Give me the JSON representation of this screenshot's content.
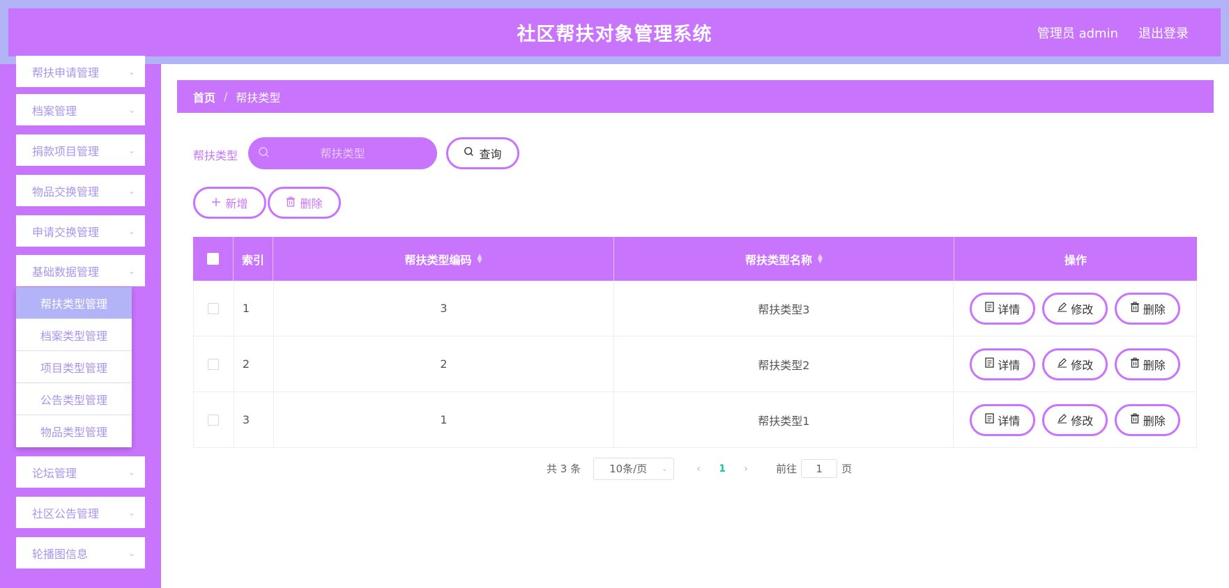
{
  "header": {
    "title": "社区帮扶对象管理系统",
    "user": "管理员 admin",
    "logout": "退出登录"
  },
  "sidebar": {
    "items": [
      {
        "label": "帮扶申请管理"
      },
      {
        "label": "档案管理"
      },
      {
        "label": "捐款项目管理"
      },
      {
        "label": "物品交换管理"
      },
      {
        "label": "申请交换管理"
      },
      {
        "label": "基础数据管理"
      },
      {
        "label": "论坛管理"
      },
      {
        "label": "社区公告管理"
      },
      {
        "label": "轮播图信息"
      }
    ],
    "submenu": [
      {
        "label": "帮扶类型管理",
        "active": true
      },
      {
        "label": "档案类型管理"
      },
      {
        "label": "项目类型管理"
      },
      {
        "label": "公告类型管理"
      },
      {
        "label": "物品类型管理"
      }
    ]
  },
  "breadcrumb": {
    "home": "首页",
    "separator": "/",
    "current": "帮扶类型"
  },
  "search": {
    "label": "帮扶类型",
    "placeholder": "帮扶类型",
    "value": "",
    "query_label": "查询"
  },
  "actions": {
    "add_label": "新增",
    "delete_label": "删除"
  },
  "table": {
    "columns": {
      "index": "索引",
      "code": "帮扶类型编码",
      "name": "帮扶类型名称",
      "ops": "操作"
    },
    "rows": [
      {
        "index": "1",
        "code": "3",
        "name": "帮扶类型3"
      },
      {
        "index": "2",
        "code": "2",
        "name": "帮扶类型2"
      },
      {
        "index": "3",
        "code": "1",
        "name": "帮扶类型1"
      }
    ],
    "row_actions": {
      "detail": "详情",
      "edit": "修改",
      "delete": "删除"
    }
  },
  "pagination": {
    "total_text": "共 3 条",
    "page_size": "10条/页",
    "current_page": "1",
    "goto_label": "前往",
    "goto_value": "1",
    "goto_suffix": "页"
  },
  "colors": {
    "primary": "#c974fd",
    "header_border": "#b3b3f8",
    "menu_text": "#a995ef",
    "active_page": "#1cc2a9"
  }
}
